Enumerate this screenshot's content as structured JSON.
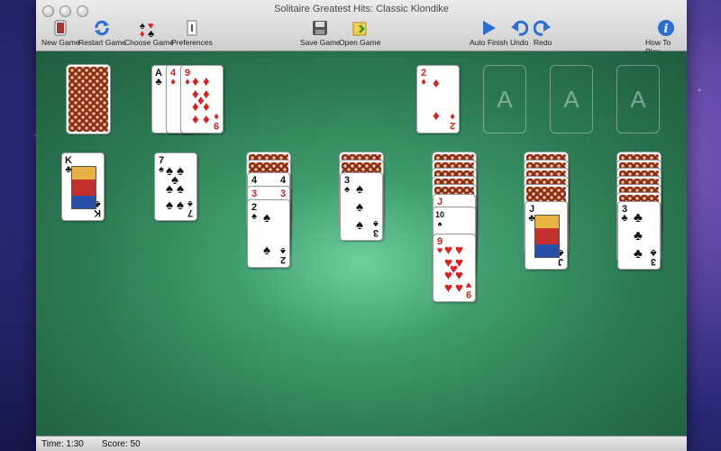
{
  "window": {
    "title": "Solitaire Greatest Hits: Classic Klondike"
  },
  "toolbar": {
    "new_game": "New Game",
    "restart_game": "Restart Game",
    "choose_game": "Choose Game",
    "preferences": "Preferences",
    "save_game": "Save Game",
    "open_game": "Open Game",
    "auto_finish": "Auto Finish",
    "undo": "Undo",
    "redo": "Redo",
    "how_to_play": "How To Play"
  },
  "status": {
    "time": "Time: 1:30",
    "score": "Score: 50"
  },
  "foundations": {
    "slot_label": "A"
  },
  "cards": {
    "waste_1": "4",
    "waste_2": "9",
    "waste_top": "9",
    "foundation_1": "2",
    "t1": "K",
    "t2": "7",
    "t3a": "4",
    "t3b": "3",
    "t3c": "2",
    "t4": "3",
    "t5a": "J",
    "t5b": "10",
    "t5c": "9",
    "t6": "J",
    "t7": "3",
    "ace": "A"
  },
  "colors": {
    "felt": "#2c7a53",
    "card_back": "#8b2a1f",
    "red_suit": "#e21b1b"
  },
  "icons": [
    "new-game-icon",
    "restart-icon",
    "choose-game-icon",
    "preferences-icon",
    "save-icon",
    "open-icon",
    "play-icon",
    "undo-icon",
    "redo-icon",
    "info-icon"
  ]
}
